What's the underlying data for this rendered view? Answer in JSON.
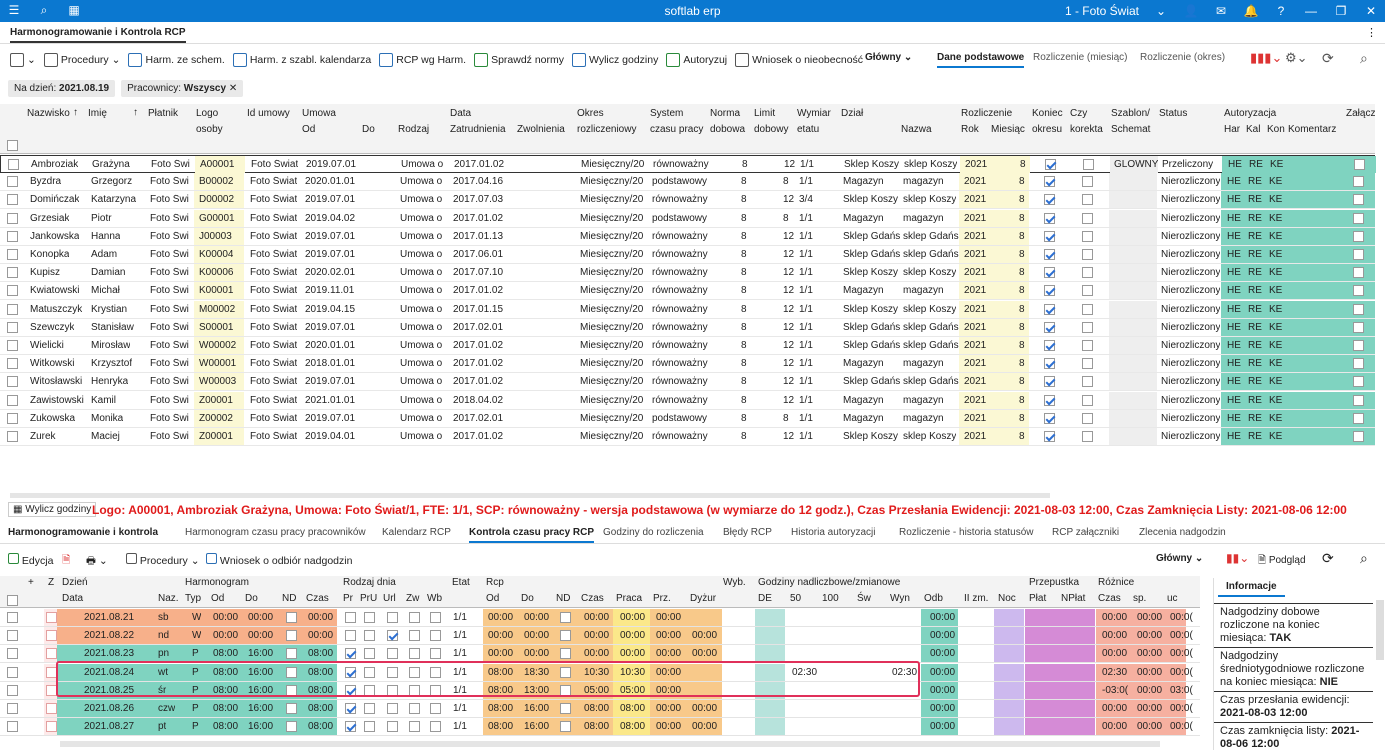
{
  "app": {
    "title": "softlab erp",
    "company": "1 - Foto Świat",
    "tab": "Harmonogramowanie i Kontrola RCP"
  },
  "toolbar": {
    "procedury": "Procedury",
    "harm_schem": "Harm. ze schem.",
    "harm_szabl": "Harm. z szabl. kalendarza",
    "rcp_harm": "RCP wg Harm.",
    "sprawdz": "Sprawdź normy",
    "wylicz": "Wylicz godziny",
    "autoryzuj": "Autoryzuj",
    "wniosek": "Wniosek o nieobecność",
    "glowny": "Główny",
    "tab_dane": "Dane podstawowe",
    "tab_rozl_m": "Rozliczenie (miesiąc)",
    "tab_rozl_o": "Rozliczenie (okres)"
  },
  "filter": {
    "na_dzien_label": "Na dzień:",
    "na_dzien": "2021.08.19",
    "pracownicy_label": "Pracownicy:",
    "pracownicy": "Wszyscy"
  },
  "headers": {
    "nazwisko": "Nazwisko",
    "imie": "Imię",
    "platnik": "Płatnik",
    "logo": "Logo",
    "osoby": "osoby",
    "id_umowy": "Id umowy",
    "umowa": "Umowa",
    "od": "Od",
    "do": "Do",
    "rodzaj": "Rodzaj",
    "data": "Data",
    "zatrudnienia": "Zatrudnienia",
    "zwolnienia": "Zwolnienia",
    "okres": "Okres",
    "rozliczeniowy": "rozliczeniowy",
    "system": "System",
    "czasu_pracy": "czasu pracy",
    "norma": "Norma",
    "dobowa": "dobowa",
    "limit": "Limit",
    "dobowy": "dobowy",
    "wymiar": "Wymiar",
    "etatu": "etatu",
    "dzial": "Dział",
    "nazwa": "Nazwa",
    "rozliczenie": "Rozliczenie",
    "rok": "Rok",
    "miesiac": "Miesiąc",
    "koniec": "Koniec",
    "okresu": "okresu",
    "czy": "Czy",
    "korekta": "korekta",
    "szablon": "Szablon/",
    "schemat": "Schemat",
    "status": "Status",
    "autoryzacja": "Autoryzacja",
    "har": "Har",
    "kal": "Kal",
    "kon": "Kon",
    "komentarz": "Komentarz",
    "zalacz": "Załącz"
  },
  "employees": [
    [
      "Ambroziak",
      "Grażyna",
      "Foto Świ",
      "A00001",
      "Foto Świat",
      "2019.07.01",
      "Umowa o",
      "2017.01.02",
      "Miesięczny/20",
      "równoważny",
      "8",
      "12",
      "1/1",
      "Sklep Koszy",
      "sklep Koszy",
      "2021",
      "8",
      true,
      "GLOWNY",
      "Przeliczony"
    ],
    [
      "Byzdra",
      "Grzegorz",
      "Foto Świ",
      "B00002",
      "Foto Świat",
      "2020.01.01",
      "Umowa o",
      "2017.04.16",
      "Miesięczny/20",
      "podstawowy",
      "8",
      "8",
      "1/1",
      "Magazyn",
      "magazyn",
      "2021",
      "8",
      true,
      "",
      "Nierozliczony"
    ],
    [
      "Domińczak",
      "Katarzyna",
      "Foto Świ",
      "D00002",
      "Foto Świat",
      "2019.07.01",
      "Umowa o",
      "2017.07.03",
      "Miesięczny/20",
      "równoważny",
      "8",
      "12",
      "3/4",
      "Sklep Koszy",
      "sklep Koszy",
      "2021",
      "8",
      true,
      "",
      "Nierozliczony"
    ],
    [
      "Grzesiak",
      "Piotr",
      "Foto Świ",
      "G00001",
      "Foto Świat",
      "2019.04.02",
      "Umowa o",
      "2017.01.02",
      "Miesięczny/20",
      "podstawowy",
      "8",
      "8",
      "1/1",
      "Magazyn",
      "magazyn",
      "2021",
      "8",
      true,
      "",
      "Nierozliczony"
    ],
    [
      "Jankowska",
      "Hanna",
      "Foto Świ",
      "J00003",
      "Foto Świat",
      "2019.07.01",
      "Umowa o",
      "2017.01.13",
      "Miesięczny/20",
      "równoważny",
      "8",
      "12",
      "1/1",
      "Sklep Gdańs",
      "sklep Gdańs",
      "2021",
      "8",
      true,
      "",
      "Nierozliczony"
    ],
    [
      "Konopka",
      "Adam",
      "Foto Świ",
      "K00004",
      "Foto Świat",
      "2019.07.01",
      "Umowa o",
      "2017.06.01",
      "Miesięczny/20",
      "równoważny",
      "8",
      "12",
      "1/1",
      "Sklep Gdańs",
      "sklep Gdańs",
      "2021",
      "8",
      true,
      "",
      "Nierozliczony"
    ],
    [
      "Kupisz",
      "Damian",
      "Foto Świ",
      "K00006",
      "Foto Świat",
      "2020.02.01",
      "Umowa o",
      "2017.07.10",
      "Miesięczny/20",
      "równoważny",
      "8",
      "12",
      "1/1",
      "Sklep Koszy",
      "sklep Koszy",
      "2021",
      "8",
      true,
      "",
      "Nierozliczony"
    ],
    [
      "Kwiatowski",
      "Michał",
      "Foto Świ",
      "K00001",
      "Foto Świat",
      "2019.11.01",
      "Umowa o",
      "2017.01.02",
      "Miesięczny/20",
      "równoważny",
      "8",
      "12",
      "1/1",
      "Magazyn",
      "magazyn",
      "2021",
      "8",
      true,
      "",
      "Nierozliczony"
    ],
    [
      "Matuszczyk",
      "Krystian",
      "Foto Świ",
      "M00002",
      "Foto Świat",
      "2019.04.15",
      "Umowa o",
      "2017.01.15",
      "Miesięczny/20",
      "równoważny",
      "8",
      "12",
      "1/1",
      "Sklep Koszy",
      "sklep Koszy",
      "2021",
      "8",
      true,
      "",
      "Nierozliczony"
    ],
    [
      "Szewczyk",
      "Stanisław",
      "Foto Świ",
      "S00001",
      "Foto Świat",
      "2019.07.01",
      "Umowa o",
      "2017.02.01",
      "Miesięczny/20",
      "równoważny",
      "8",
      "12",
      "1/1",
      "Sklep Gdańs",
      "sklep Gdańs",
      "2021",
      "8",
      true,
      "",
      "Nierozliczony"
    ],
    [
      "Wielicki",
      "Mirosław",
      "Foto Świ",
      "W00002",
      "Foto Świat",
      "2020.01.01",
      "Umowa o",
      "2017.01.02",
      "Miesięczny/20",
      "równoważny",
      "8",
      "12",
      "1/1",
      "Sklep Gdańs",
      "sklep Gdańs",
      "2021",
      "8",
      true,
      "",
      "Nierozliczony"
    ],
    [
      "Witkowski",
      "Krzysztof",
      "Foto Świ",
      "W00001",
      "Foto Świat",
      "2018.01.01",
      "Umowa o",
      "2017.01.02",
      "Miesięczny/20",
      "równoważny",
      "8",
      "12",
      "1/1",
      "Magazyn",
      "magazyn",
      "2021",
      "8",
      true,
      "",
      "Nierozliczony"
    ],
    [
      "Witosławski",
      "Henryka",
      "Foto Świ",
      "W00003",
      "Foto Świat",
      "2019.07.01",
      "Umowa o",
      "2017.01.02",
      "Miesięczny/20",
      "równoważny",
      "8",
      "12",
      "1/1",
      "Sklep Gdańs",
      "sklep Gdańs",
      "2021",
      "8",
      true,
      "",
      "Nierozliczony"
    ],
    [
      "Zawistowski",
      "Kamil",
      "Foto Świ",
      "Z00001",
      "Foto Świat",
      "2021.01.01",
      "Umowa o",
      "2018.04.02",
      "Miesięczny/20",
      "równoważny",
      "8",
      "12",
      "1/1",
      "Magazyn",
      "magazyn",
      "2021",
      "8",
      true,
      "",
      "Nierozliczony"
    ],
    [
      "Żukowska",
      "Monika",
      "Foto Świ",
      "Ż00002",
      "Foto Świat",
      "2019.07.01",
      "Umowa o",
      "2017.02.01",
      "Miesięczny/20",
      "podstawowy",
      "8",
      "8",
      "1/1",
      "Magazyn",
      "magazyn",
      "2021",
      "8",
      true,
      "",
      "Nierozliczony"
    ],
    [
      "Żurek",
      "Maciej",
      "Foto Świ",
      "Ż00001",
      "Foto Świat",
      "2019.04.01",
      "Umowa o",
      "2017.01.02",
      "Miesięczny/20",
      "równoważny",
      "8",
      "12",
      "1/1",
      "Sklep Koszy",
      "sklep Koszy",
      "2021",
      "8",
      true,
      "",
      "Nierozliczony"
    ]
  ],
  "auth": [
    "HE",
    "RE",
    "KE"
  ],
  "info_bar": {
    "wylicz": "Wylicz godziny",
    "text": "Logo: A00001, Ambroziak Grażyna, Umowa: Foto Świat/1, FTE: 1/1, SCP: równoważny - wersja podstawowa (w wymiarze do 12 godz.), Czas Przesłania Ewidencji: 2021-08-03 12:00, Czas Zamknięcia Listy: 2021-08-06 12:00"
  },
  "tabs2": [
    "Harmonogramowanie i kontrola",
    "Harmonogram czasu pracy pracowników",
    "Kalendarz RCP",
    "Kontrola czasu pracy RCP",
    "Godziny do rozliczenia",
    "Błędy RCP",
    "Historia autoryzacji",
    "Rozliczenie - historia statusów",
    "RCP załączniki",
    "Zlecenia nadgodzin"
  ],
  "toolbar2": {
    "edycja": "Edycja",
    "procedury": "Procedury",
    "wniosek": "Wniosek o odbiór nadgodzin",
    "glowny": "Główny",
    "podglad": "Podgląd"
  },
  "h2": {
    "plus": "+",
    "z": "Z",
    "dzien": "Dzień",
    "data": "Data",
    "naz": "Naz.",
    "harm": "Harmonogram",
    "typ": "Typ",
    "od": "Od",
    "do": "Do",
    "nd": "ND",
    "czas": "Czas",
    "rodzaj": "Rodzaj dnia",
    "pr": "Pr",
    "pru": "PrU",
    "url": "Url",
    "zw": "Zw",
    "wb": "Wb",
    "etat": "Etat",
    "rcp": "Rcp",
    "rod": "Od",
    "rdo": "Do",
    "rnd": "ND",
    "rczas": "Czas",
    "praca": "Praca",
    "prz": "Prz.",
    "dyzur": "Dyżur",
    "wyb": "Wyb.",
    "godz": "Godziny nadliczbowe/zmianowe",
    "de": "DE",
    "p50": "50",
    "p100": "100",
    "sw": "Św",
    "wyn": "Wyn",
    "odb": "Odb",
    "iizm": "II zm.",
    "noc": "Noc",
    "przepustka": "Przepustka",
    "plat": "Płat",
    "nplat": "NPłat",
    "roznice": "Różnice",
    "rcz": "Czas",
    "sp": "sp.",
    "uc": "uc"
  },
  "days": [
    [
      "2021.08.21",
      "sb",
      "W",
      "00:00",
      "00:00",
      "00:00",
      false,
      "1/1",
      "00:00",
      "00:00",
      "00:00",
      "00:00",
      "00:00",
      "",
      "",
      "",
      "00:00",
      "00:00",
      "00:00",
      "00:0("
    ],
    [
      "2021.08.22",
      "nd",
      "W",
      "00:00",
      "00:00",
      "00:00",
      false,
      "1/1",
      "00:00",
      "00:00",
      "00:00",
      "00:00",
      "00:00",
      "00:00",
      "",
      "",
      "00:00",
      "00:00",
      "00:00",
      "00:0("
    ],
    [
      "2021.08.23",
      "pn",
      "P",
      "08:00",
      "16:00",
      "08:00",
      true,
      "1/1",
      "00:00",
      "00:00",
      "00:00",
      "00:00",
      "00:00",
      "00:00",
      "",
      "",
      "00:00",
      "00:00",
      "00:00",
      "00:0("
    ],
    [
      "2021.08.24",
      "wt",
      "P",
      "08:00",
      "16:00",
      "08:00",
      true,
      "1/1",
      "08:00",
      "18:30",
      "10:30",
      "10:30",
      "00:00",
      "",
      "02:30",
      "02:30",
      "00:00",
      "02:30",
      "00:00",
      "00:0("
    ],
    [
      "2021.08.25",
      "śr",
      "P",
      "08:00",
      "16:00",
      "08:00",
      true,
      "1/1",
      "08:00",
      "13:00",
      "05:00",
      "05:00",
      "00:00",
      "",
      "",
      "",
      "00:00",
      "-03:0(",
      "00:00",
      "03:0("
    ],
    [
      "2021.08.26",
      "czw",
      "P",
      "08:00",
      "16:00",
      "08:00",
      true,
      "1/1",
      "08:00",
      "16:00",
      "08:00",
      "08:00",
      "00:00",
      "00:00",
      "",
      "",
      "00:00",
      "00:00",
      "00:00",
      "00:0("
    ],
    [
      "2021.08.27",
      "pt",
      "P",
      "08:00",
      "16:00",
      "08:00",
      true,
      "1/1",
      "08:00",
      "16:00",
      "08:00",
      "08:00",
      "00:00",
      "00:00",
      "",
      "",
      "00:00",
      "00:00",
      "00:00",
      "00:0("
    ]
  ],
  "info": {
    "tab": "Informacje",
    "l1": "Nadgodziny dobowe rozliczone na koniec miesiąca: ",
    "v1": "TAK",
    "l2": "Nadgodziny średniotygodniowe rozliczone na koniec miesiąca: ",
    "v2": "NIE",
    "l3": "Czas przesłania ewidencji:",
    "v3": "2021-08-03 12:00",
    "l4": "Czas zamknięcia listy: ",
    "v4": "2021-08-06 12:00"
  }
}
